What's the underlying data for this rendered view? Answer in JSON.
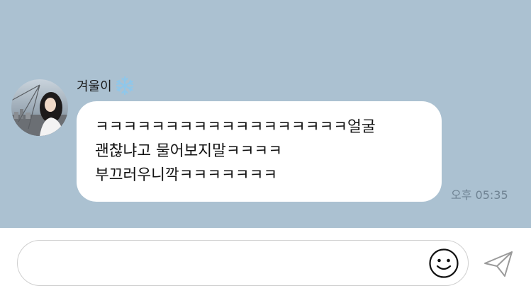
{
  "message": {
    "sender_name": "겨울이",
    "sender_badge_icon": "snowflake-icon",
    "lines": [
      "ㅋㅋㅋㅋㅋㅋㅋㅋㅋㅋㅋㅋㅋㅋㅋㅋㅋㅋ얼굴",
      "괜찮냐고 물어보지말ㅋㅋㅋㅋ",
      "부끄러우니깍ㅋㅋㅋㅋㅋㅋㅋ"
    ],
    "time": "오후 05:35"
  },
  "input": {
    "placeholder": "",
    "value": "",
    "emoji_icon": "smiley-icon",
    "send_icon": "send-icon"
  },
  "colors": {
    "chat_background": "#abc1d1",
    "bubble": "#ffffff",
    "input_background": "#ffffff",
    "timestamp": "#6f8393"
  }
}
